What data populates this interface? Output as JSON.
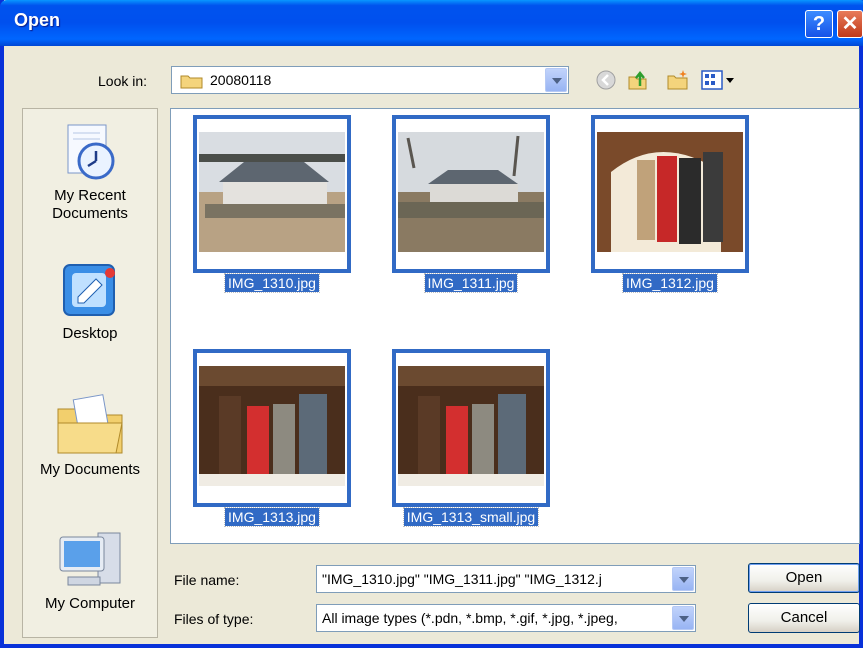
{
  "window": {
    "title": "Open",
    "help_label": "?",
    "close_label": "✕"
  },
  "toolbar": {
    "lookin_label": "Look in:",
    "lookin_value": "20080118",
    "icons": [
      "back-icon",
      "up-folder-icon",
      "new-folder-icon",
      "views-menu-icon"
    ]
  },
  "places": [
    {
      "label": "My Recent Documents",
      "icon": "recent-documents-icon"
    },
    {
      "label": "Desktop",
      "icon": "desktop-icon"
    },
    {
      "label": "My Documents",
      "icon": "my-documents-icon"
    },
    {
      "label": "My Computer",
      "icon": "my-computer-icon"
    }
  ],
  "files": [
    {
      "name": "IMG_1310.jpg"
    },
    {
      "name": "IMG_1311.jpg"
    },
    {
      "name": "IMG_1312.jpg"
    },
    {
      "name": "IMG_1313.jpg"
    },
    {
      "name": "IMG_1313_small.jpg"
    }
  ],
  "bottom": {
    "filename_label": "File name:",
    "filename_value": "\"IMG_1310.jpg\" \"IMG_1311.jpg\" \"IMG_1312.j",
    "filetype_label": "Files of type:",
    "filetype_value": "All image types (*.pdn, *.bmp, *.gif, *.jpg, *.jpeg,",
    "open_label": "Open",
    "cancel_label": "Cancel"
  },
  "colors": {
    "selection": "#316ac5",
    "titlebar": "#0053ee",
    "dialog_bg": "#ece9d8"
  }
}
